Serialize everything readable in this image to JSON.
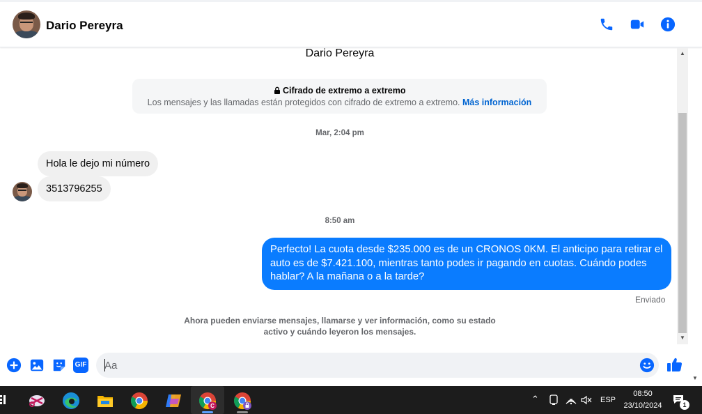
{
  "header": {
    "name": "Dario Pereyra",
    "icons": [
      "phone-icon",
      "video-camera-icon",
      "info-icon"
    ]
  },
  "chat": {
    "title": "Dario Pereyra",
    "encryption": {
      "title": "Cifrado de extremo a extremo",
      "description": "Los mensajes y las llamadas están protegidos con cifrado de extremo a extremo.",
      "link": "Más información"
    },
    "timestamp_1": "Mar, 2:04 pm",
    "incoming": [
      {
        "text": "Hola le dejo mi número"
      },
      {
        "text": "3513796255"
      }
    ],
    "timestamp_2": "8:50 am",
    "outgoing": {
      "text": "Perfecto! La cuota desde $235.000 es de un CRONOS 0KM. El anticipo para retirar el auto es de $7.421.100, mientras tanto podes ir pagando en cuotas. Cuándo podes hablar? A la mañana o a la tarde?"
    },
    "status": "Enviado",
    "notice": "Ahora pueden enviarse mensajes, llamarse y ver información, como su estado activo y cuándo leyeron los mensajes."
  },
  "composer": {
    "placeholder": "Aa",
    "value": "",
    "gif_label": "GIF",
    "icons": [
      "add-icon",
      "image-icon",
      "sticker-icon",
      "gif-icon",
      "emoji-icon",
      "thumbs-up-icon"
    ]
  },
  "colors": {
    "accent": "#0a7cff",
    "icon_blue": "#0866ff",
    "incoming_bubble": "#f0f0f0",
    "taskbar": "#1c1c1c"
  },
  "taskbar": {
    "apps": [
      "snipping-tool-icon",
      "edge-icon",
      "file-explorer-icon",
      "chrome-icon",
      "copilot-icon",
      "chrome-profile-c-icon",
      "chrome-profile-lock-icon"
    ],
    "language": "ESP",
    "time": "08:50",
    "date": "23/10/2024",
    "notification_count": "1"
  }
}
